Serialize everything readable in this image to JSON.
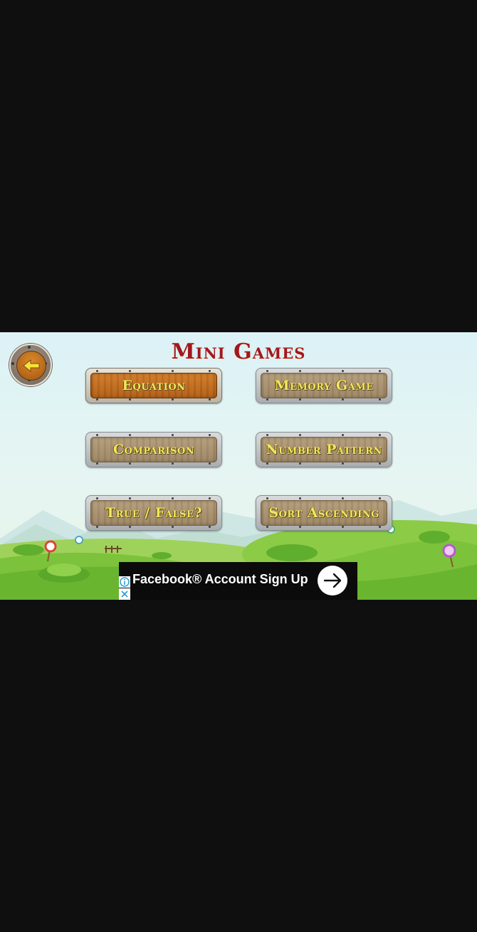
{
  "title": "Mini Games",
  "back_button": {
    "icon": "arrow-left-icon"
  },
  "menu": {
    "buttons": [
      {
        "label": "Equation",
        "active": true
      },
      {
        "label": "Memory Game",
        "active": false
      },
      {
        "label": "Comparison",
        "active": false
      },
      {
        "label": "Number Pattern",
        "active": false
      },
      {
        "label": "True / False?",
        "active": false
      },
      {
        "label": "Sort Ascending",
        "active": false
      }
    ]
  },
  "ad": {
    "text": "Facebook® Account Sign Up",
    "icons": [
      "info-icon",
      "close-icon",
      "arrow-right-icon"
    ]
  },
  "colors": {
    "title": "#a3171e",
    "button_label": "#f2e85a",
    "active_plank": "#c96e1e",
    "inactive_plank": "#a8916d",
    "grass": "#7cc23a"
  }
}
